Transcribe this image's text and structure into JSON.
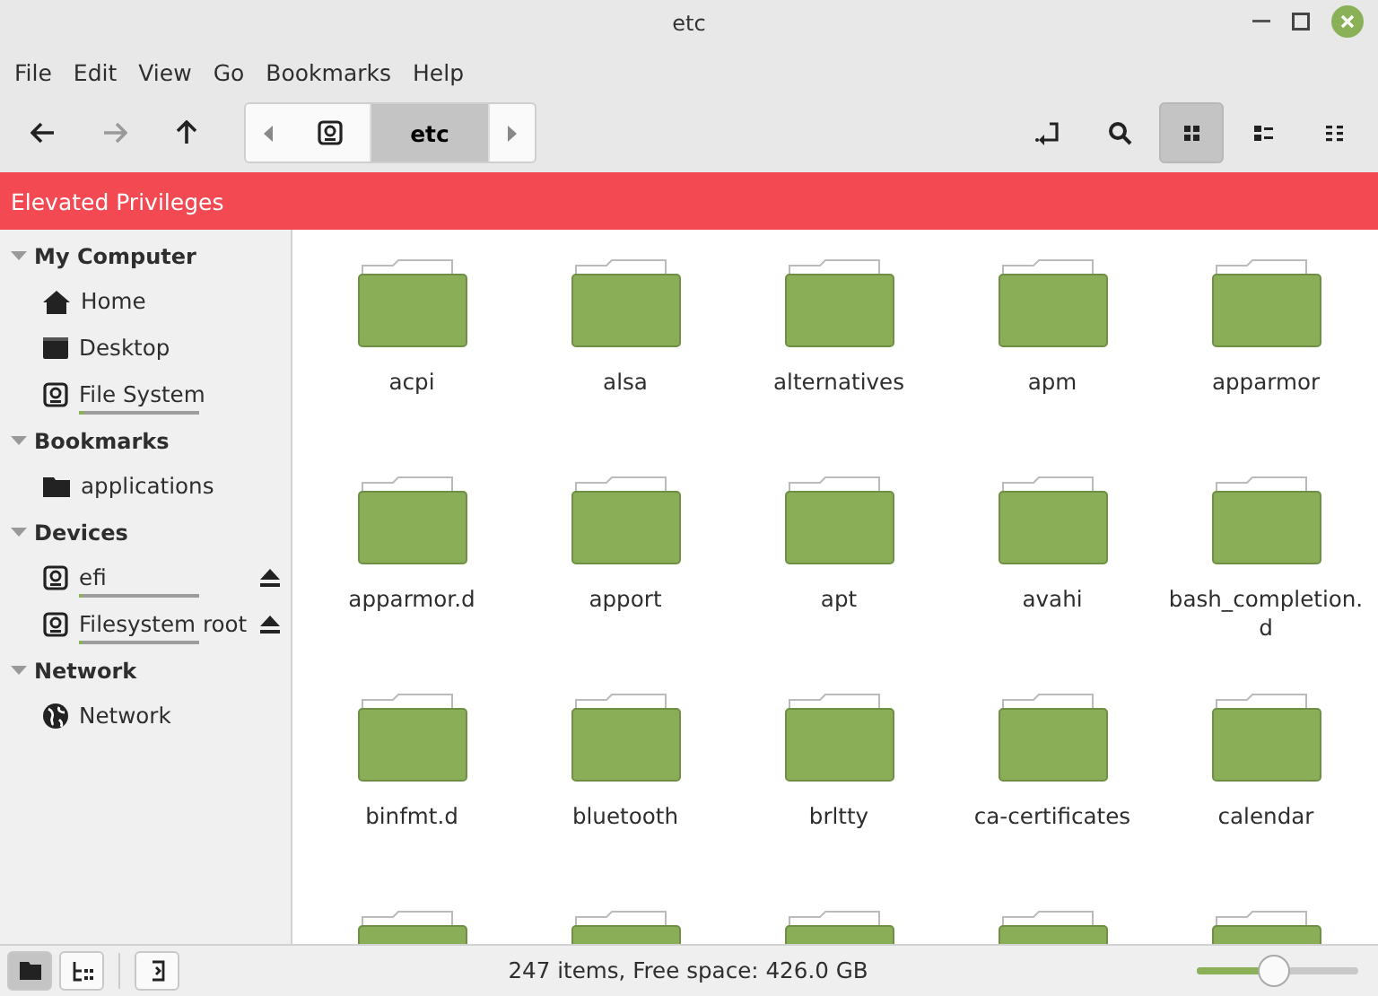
{
  "window": {
    "title": "etc"
  },
  "menu": [
    "File",
    "Edit",
    "View",
    "Go",
    "Bookmarks",
    "Help"
  ],
  "path": [
    {
      "kind": "drive",
      "selected": false
    },
    {
      "kind": "text",
      "label": "etc",
      "selected": true
    }
  ],
  "view_buttons": [
    {
      "kind": "toggle-location",
      "selected": false
    },
    {
      "kind": "search",
      "selected": false
    },
    {
      "kind": "icons",
      "selected": true
    },
    {
      "kind": "list",
      "selected": false
    },
    {
      "kind": "compact",
      "selected": false
    }
  ],
  "banner": "Elevated Privileges",
  "sidebar": [
    {
      "title": "My Computer",
      "expanded": true,
      "children": [
        {
          "label": "Home",
          "kind": "home"
        },
        {
          "label": "Desktop",
          "kind": "desktop"
        },
        {
          "label": "File System",
          "kind": "drive",
          "level": 0.05
        }
      ]
    },
    {
      "title": "Bookmarks",
      "expanded": true,
      "children": [
        {
          "label": "applications",
          "kind": "folder"
        }
      ]
    },
    {
      "title": "Devices",
      "expanded": true,
      "children": [
        {
          "label": "efi",
          "kind": "drive",
          "level": 0.03,
          "eject": true
        },
        {
          "label": "Filesystem root",
          "kind": "drive",
          "level": 0.03,
          "eject": true
        }
      ]
    },
    {
      "title": "Network",
      "expanded": true,
      "children": [
        {
          "label": "Network",
          "kind": "globe"
        }
      ]
    }
  ],
  "items": [
    {
      "kind": "folder",
      "name": "acpi"
    },
    {
      "kind": "folder",
      "name": "alsa"
    },
    {
      "kind": "folder",
      "name": "alternatives"
    },
    {
      "kind": "folder",
      "name": "apm"
    },
    {
      "kind": "folder",
      "name": "apparmor"
    },
    {
      "kind": "folder",
      "name": "apparmor.d"
    },
    {
      "kind": "folder",
      "name": "apport"
    },
    {
      "kind": "folder",
      "name": "apt"
    },
    {
      "kind": "folder",
      "name": "avahi"
    },
    {
      "kind": "folder",
      "name": "bash_completion.d"
    },
    {
      "kind": "folder",
      "name": "binfmt.d"
    },
    {
      "kind": "folder",
      "name": "bluetooth"
    },
    {
      "kind": "folder",
      "name": "brltty"
    },
    {
      "kind": "folder",
      "name": "ca-certificates"
    },
    {
      "kind": "folder",
      "name": "calendar"
    },
    {
      "kind": "folder"
    },
    {
      "kind": "folder"
    },
    {
      "kind": "folder"
    },
    {
      "kind": "folder"
    },
    {
      "kind": "folder"
    }
  ],
  "status_bar": {
    "buttons": [
      {
        "kind": "places",
        "selected": true
      },
      {
        "kind": "tree",
        "selected": false
      },
      {
        "kind": "terminal",
        "selected": false
      }
    ],
    "text": "247 items, Free space: 426.0 GB",
    "zoom": {
      "level": 0.48
    }
  }
}
